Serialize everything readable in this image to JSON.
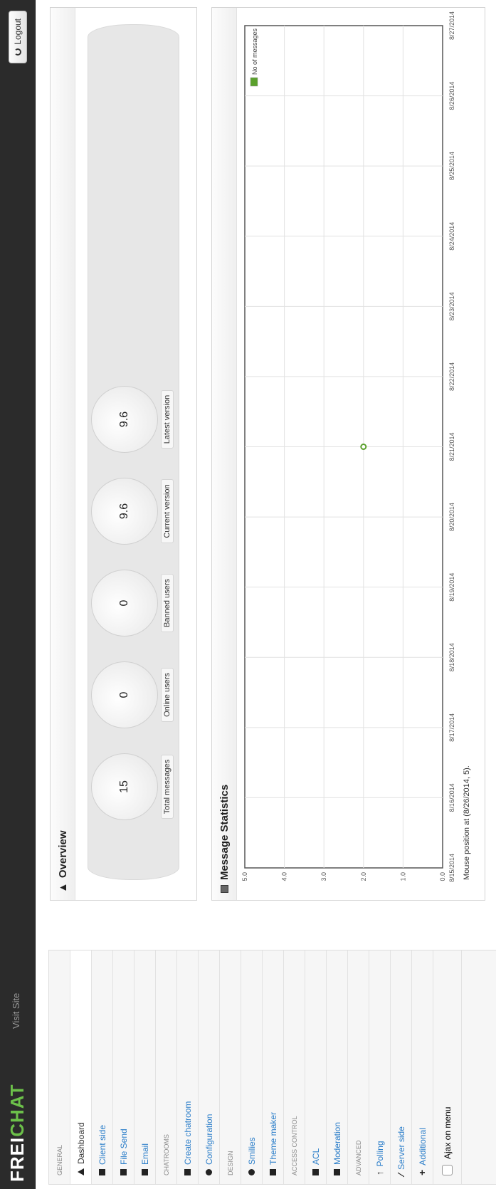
{
  "topbar": {
    "logo_white": "FREI",
    "logo_green": "CHAT",
    "visit_site": "Visit Site",
    "logout": "Logout"
  },
  "sidebar": {
    "items": [
      {
        "type": "head",
        "label": "GENERAL"
      },
      {
        "type": "link",
        "label": "Dashboard",
        "active": true,
        "icon": "home-icon"
      },
      {
        "type": "link",
        "label": "Client side",
        "icon": "client-icon"
      },
      {
        "type": "link",
        "label": "File Send",
        "icon": "file-icon"
      },
      {
        "type": "link",
        "label": "Email",
        "icon": "email-icon"
      },
      {
        "type": "head",
        "label": "CHATROOMS"
      },
      {
        "type": "link",
        "label": "Create chatroom",
        "icon": "chatroom-icon"
      },
      {
        "type": "link",
        "label": "Configuration",
        "icon": "gear-icon"
      },
      {
        "type": "head",
        "label": "DESIGN"
      },
      {
        "type": "link",
        "label": "Smilies",
        "icon": "smiley-icon"
      },
      {
        "type": "link",
        "label": "Theme maker",
        "icon": "image-icon"
      },
      {
        "type": "head",
        "label": "ACCESS CONTROL"
      },
      {
        "type": "link",
        "label": "ACL",
        "icon": "lock-icon"
      },
      {
        "type": "link",
        "label": "Moderation",
        "icon": "user-icon"
      },
      {
        "type": "head",
        "label": "ADVANCED"
      },
      {
        "type": "link",
        "label": "Polling",
        "icon": "arrow-up-icon"
      },
      {
        "type": "link",
        "label": "Server side",
        "icon": "wrench-icon"
      },
      {
        "type": "link",
        "label": "Additional",
        "icon": "plus-icon"
      }
    ],
    "ajax_checkbox": "Ajax on menu"
  },
  "overview": {
    "title": "Overview",
    "stats": [
      {
        "label": "Total messages",
        "value": "15"
      },
      {
        "label": "Online users",
        "value": "0"
      },
      {
        "label": "Banned users",
        "value": "0"
      },
      {
        "label": "Current version",
        "value": "9.6"
      },
      {
        "label": "Latest version",
        "value": "9.6"
      }
    ]
  },
  "stats": {
    "title": "Message Statistics",
    "mouse_position": "Mouse position at (8/26/2014, 5)."
  },
  "chart_data": {
    "type": "line",
    "x": [
      "8/15/2014",
      "8/16/2014",
      "8/17/2014",
      "8/18/2014",
      "8/19/2014",
      "8/20/2014",
      "8/21/2014",
      "8/22/2014",
      "8/23/2014",
      "8/24/2014",
      "8/25/2014",
      "8/26/2014",
      "8/27/2014"
    ],
    "series": [
      {
        "name": "No of messages",
        "points": [
          {
            "x": "8/21/2014",
            "y": 2.0
          }
        ],
        "color": "#5aa02c"
      }
    ],
    "yticks": [
      "0.0",
      "1.0",
      "2.0",
      "3.0",
      "4.0",
      "5.0"
    ],
    "ylim": [
      0,
      5
    ],
    "grid": true,
    "legend": "top-right"
  }
}
